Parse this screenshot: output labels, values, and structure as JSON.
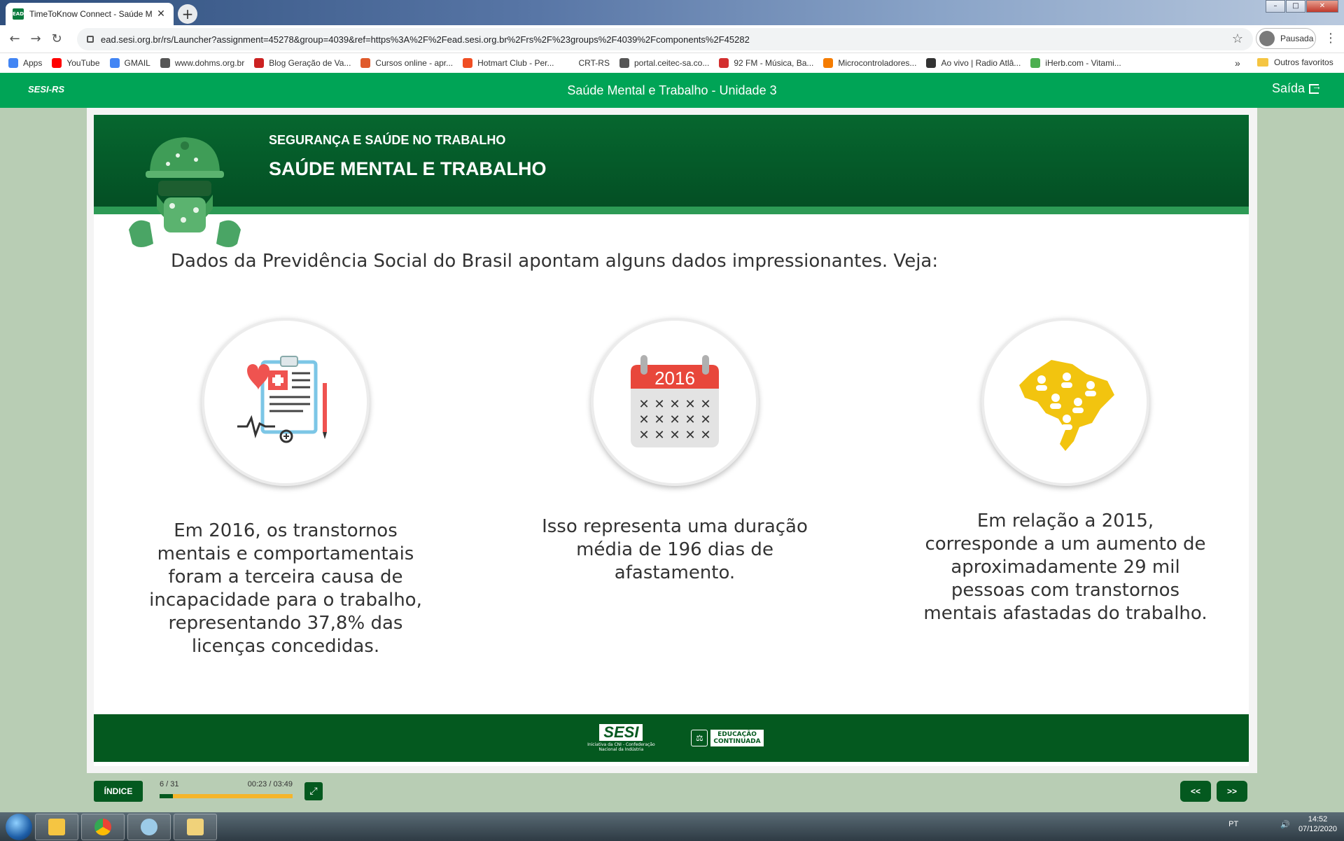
{
  "browser": {
    "tab_title": "TimeToKnow Connect - Saúde M",
    "tab_favicon": "EAD",
    "url": "ead.sesi.org.br/rs/Launcher?assignment=45278&group=4039&ref=https%3A%2F%2Fead.sesi.org.br%2Frs%2F%23groups%2F4039%2Fcomponents%2F45282",
    "profile_label": "Pausada",
    "bookmarks": [
      {
        "label": "Apps",
        "color": "#4285f4"
      },
      {
        "label": "YouTube",
        "color": "#ff0000"
      },
      {
        "label": "GMAIL",
        "color": "#4285f4"
      },
      {
        "label": "www.dohms.org.br",
        "color": "#555555"
      },
      {
        "label": "Blog Geração de Va...",
        "color": "#cc2222"
      },
      {
        "label": "Cursos online - apr...",
        "color": "#e05a2b"
      },
      {
        "label": "Hotmart Club - Per...",
        "color": "#f04e23"
      },
      {
        "label": "CRT-RS",
        "color": "#ffffff"
      },
      {
        "label": "portal.ceitec-sa.co...",
        "color": "#555555"
      },
      {
        "label": "92 FM - Música, Ba...",
        "color": "#d32f2f"
      },
      {
        "label": "Microcontroladores...",
        "color": "#f57c00"
      },
      {
        "label": "Ao vivo | Radio Atlâ...",
        "color": "#333333"
      },
      {
        "label": "iHerb.com - Vitami...",
        "color": "#4caf50"
      }
    ],
    "bookmarks_more": "»",
    "other_bookmarks": "Outros favoritos"
  },
  "app": {
    "logo": "SESI-RS",
    "title": "Saúde Mental e Trabalho - Unidade 3",
    "exit_label": "Saída"
  },
  "slide": {
    "banner_subtitle": "SEGURANÇA E SAÚDE NO TRABALHO",
    "banner_title": "SAÚDE MENTAL E TRABALHO",
    "intro": "Dados da Previdência Social do Brasil apontam alguns dados impressionantes. Veja:",
    "columns": [
      {
        "icon": "medical-clipboard-icon",
        "text": "Em 2016, os transtornos mentais e comportamentais foram a terceira causa de incapacidade para o trabalho, representando 37,8% das licenças concedidas."
      },
      {
        "icon": "calendar-icon",
        "calendar_year": "2016",
        "text": "Isso representa uma duração média de 196 dias de afastamento."
      },
      {
        "icon": "brazil-map-people-icon",
        "text": "Em relação a 2015, corresponde a um aumento de aproximadamente 29 mil pessoas com transtornos mentais afastadas do trabalho."
      }
    ],
    "footer": {
      "sesi": "SESI",
      "sesi_tagline": "Iniciativa da CNI - Confederação Nacional da Indústria",
      "edu_line1": "EDUCAÇÃO",
      "edu_line2": "CONTINUADA"
    }
  },
  "player": {
    "index_label": "ÍNDICE",
    "page_counter": "6 / 31",
    "time": "00:23 / 03:49",
    "progress": 0.1,
    "prev_label": "<<",
    "next_label": ">>"
  },
  "taskbar": {
    "language": "PT",
    "time": "14:52",
    "date": "07/12/2020"
  },
  "colors": {
    "brand_green": "#00a456",
    "dark_green": "#04591f",
    "progress_orange": "#f5b52a"
  }
}
